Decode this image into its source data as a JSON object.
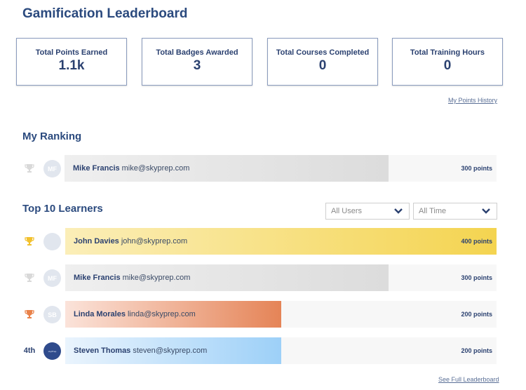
{
  "page": {
    "title": "Gamification Leaderboard"
  },
  "stats": [
    {
      "label": "Total Points Earned",
      "value": "1.1k"
    },
    {
      "label": "Total Badges Awarded",
      "value": "3"
    },
    {
      "label": "Total Courses Completed",
      "value": "0"
    },
    {
      "label": "Total Training Hours",
      "value": "0"
    }
  ],
  "links": {
    "points_history": "My Points History",
    "full_leaderboard": "See Full Leaderboard"
  },
  "my_ranking": {
    "heading": "My Ranking",
    "entry": {
      "rank_icon": "trophy-silver-icon",
      "initials": "MF",
      "name": "Mike Francis",
      "email": "mike@skyprep.com",
      "points_label": "300 points",
      "points": 300,
      "fill_fraction": 0.75
    }
  },
  "top_learners": {
    "heading": "Top 10 Learners",
    "filters": {
      "users": "All Users",
      "period": "All Time"
    },
    "max_points": 400,
    "entries": [
      {
        "rank": "1st",
        "rank_icon": "trophy-gold-icon",
        "initials": "",
        "name": "John Davies",
        "email": "john@skyprep.com",
        "points": 400,
        "points_label": "400 points"
      },
      {
        "rank": "2nd",
        "rank_icon": "trophy-silver-icon",
        "initials": "MF",
        "name": "Mike Francis",
        "email": "mike@skyprep.com",
        "points": 300,
        "points_label": "300 points"
      },
      {
        "rank": "3rd",
        "rank_icon": "trophy-bronze-icon",
        "initials": "SB",
        "name": "Linda Morales",
        "email": "linda@skyprep.com",
        "points": 200,
        "points_label": "200 points"
      },
      {
        "rank": "4th",
        "rank_icon": "",
        "initials": "skyPrep",
        "name": "Steven Thomas",
        "email": "steven@skyprep.com",
        "points": 200,
        "points_label": "200 points"
      }
    ]
  },
  "colors": {
    "gold": [
      "#fbeeb8",
      "#f4d450"
    ],
    "silver": [
      "#efefef",
      "#dcdcdc"
    ],
    "bronze": [
      "#fbe3da",
      "#e58457"
    ],
    "blue": [
      "#eaf4fd",
      "#9dd0f8"
    ],
    "trophy_gold": "#f2c12e",
    "trophy_silver": "#d9d9d9",
    "trophy_bronze": "#e9824a"
  }
}
